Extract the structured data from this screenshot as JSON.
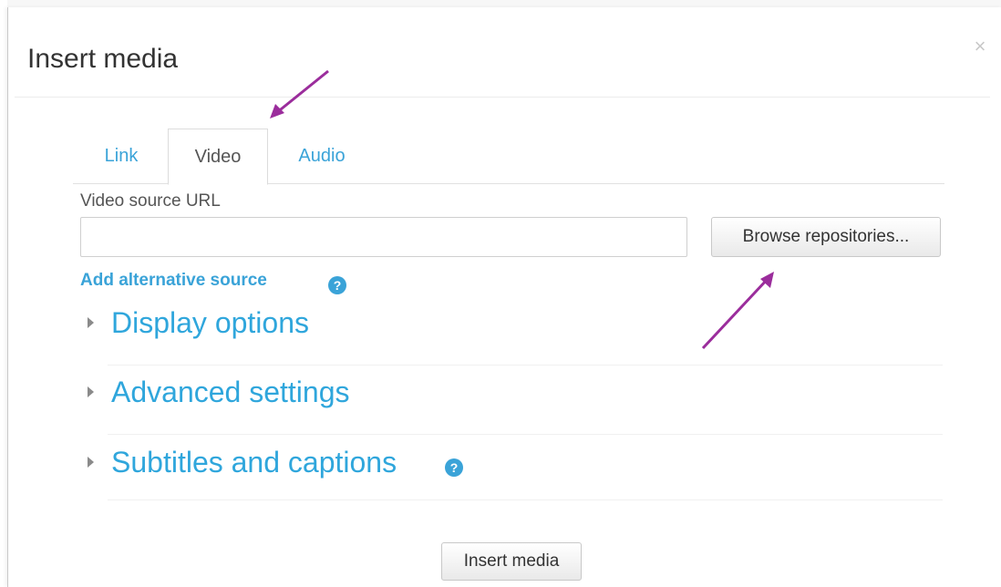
{
  "dialog": {
    "title": "Insert media",
    "close_symbol": "×"
  },
  "tabs": [
    {
      "label": "Link",
      "active": false
    },
    {
      "label": "Video",
      "active": true
    },
    {
      "label": "Audio",
      "active": false
    }
  ],
  "video": {
    "source_label": "Video source URL",
    "source_value": "",
    "browse_label": "Browse repositories...",
    "add_alternative_label": "Add alternative source",
    "help_symbol": "?"
  },
  "sections": [
    {
      "label": "Display options",
      "has_help": false
    },
    {
      "label": "Advanced settings",
      "has_help": false
    },
    {
      "label": "Subtitles and captions",
      "has_help": true
    }
  ],
  "footer": {
    "insert_label": "Insert media"
  },
  "colors": {
    "link": "#3aa3d8",
    "annotation_arrow": "#9b2d9c"
  }
}
